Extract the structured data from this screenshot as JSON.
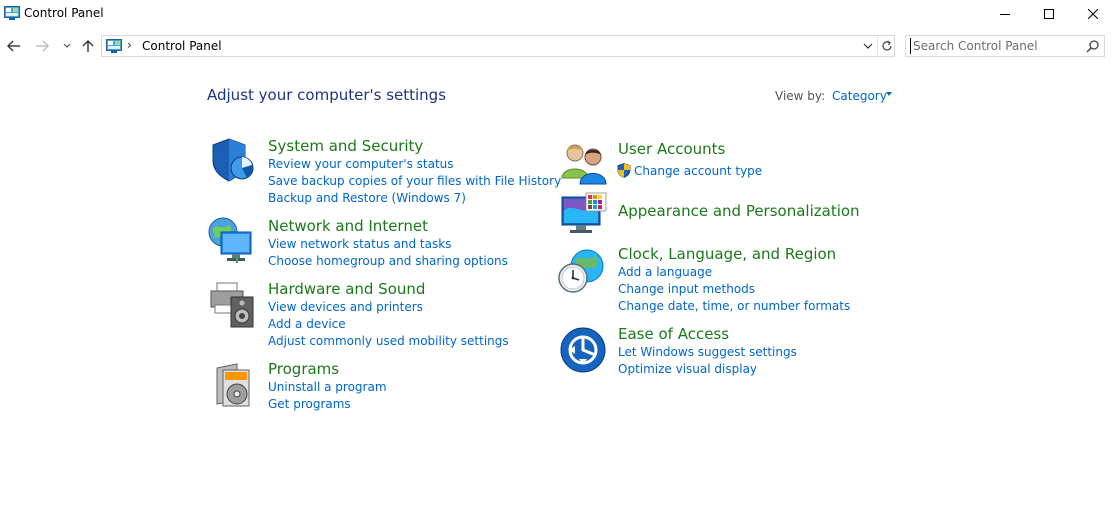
{
  "window": {
    "title": "Control Panel",
    "icon": "control-panel-icon",
    "controls": [
      "minimize-icon",
      "maximize-icon",
      "close-icon"
    ]
  },
  "nav": {
    "icons": [
      "back-arrow-icon",
      "forward-arrow-icon",
      "recent-locations-chevron-icon",
      "up-arrow-icon"
    ],
    "address": {
      "separator": "›",
      "path": "Control Panel"
    },
    "search": {
      "placeholder": "Search Control Panel"
    }
  },
  "main": {
    "heading": "Adjust your computer's settings",
    "view_by": {
      "label": "View by:",
      "value": "Category"
    },
    "left_categories": [
      {
        "title": "System and Security",
        "icon": "shield-icon",
        "links": [
          "Review your computer's status",
          "Save backup copies of your files with File History",
          "Backup and Restore (Windows 7)"
        ]
      },
      {
        "title": "Network and Internet",
        "icon": "network-globe-icon",
        "links": [
          "View network status and tasks",
          "Choose homegroup and sharing options"
        ]
      },
      {
        "title": "Hardware and Sound",
        "icon": "printer-speaker-icon",
        "links": [
          "View devices and printers",
          "Add a device",
          "Adjust commonly used mobility settings"
        ]
      },
      {
        "title": "Programs",
        "icon": "programs-disc-icon",
        "links": [
          "Uninstall a program",
          "Get programs"
        ]
      }
    ],
    "right_categories": [
      {
        "title": "User Accounts",
        "icon": "users-icon",
        "links": [
          "Change account type"
        ]
      },
      {
        "title": "Appearance and Personalization",
        "icon": "monitor-palette-icon",
        "links": []
      },
      {
        "title": "Clock, Language, and Region",
        "icon": "clock-globe-icon",
        "links": [
          "Add a language",
          "Change input methods",
          "Change date, time, or number formats"
        ]
      },
      {
        "title": "Ease of Access",
        "icon": "ease-of-access-icon",
        "links": [
          "Let Windows suggest settings",
          "Optimize visual display"
        ]
      }
    ]
  },
  "colors": {
    "heading": "#1e3287",
    "category_title": "#1a7a1a",
    "link": "#0066cc"
  }
}
